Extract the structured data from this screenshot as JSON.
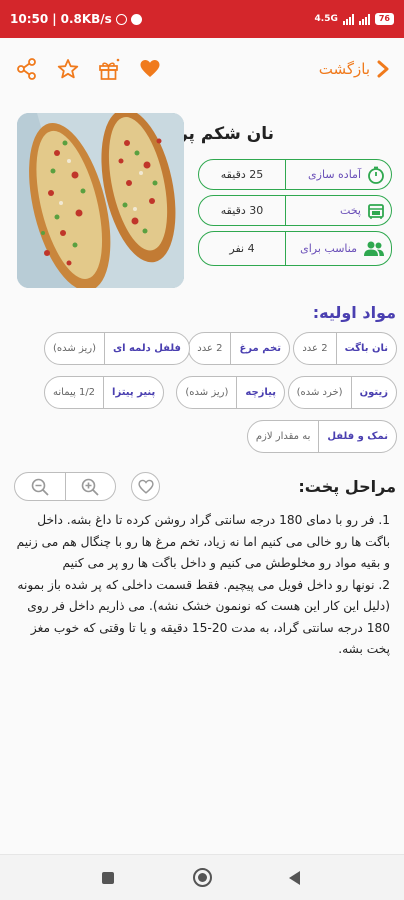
{
  "status": {
    "time": "10:50",
    "speed": "0.8KB/s",
    "network": "4.5G",
    "battery": "76"
  },
  "colors": {
    "status_red": "#d4262b",
    "accent_orange": "#f07a1c",
    "green": "#2fa84f",
    "purple": "#4a3fb0"
  },
  "toolbar": {
    "back_label": "بازگشت",
    "icons": [
      "share-icon",
      "star-icon",
      "gift-icon",
      "heart-icon"
    ]
  },
  "recipe": {
    "title": "نان شکم پر",
    "info": [
      {
        "icon": "clock-icon",
        "label": "آماده سازی",
        "value": "25 دقیقه"
      },
      {
        "icon": "oven-icon",
        "label": "پخت",
        "value": "30 دقیقه"
      },
      {
        "icon": "people-icon",
        "label": "مناسب برای",
        "value": "4 نفر"
      }
    ]
  },
  "ingredients": {
    "title": "مواد اولیه:",
    "items": [
      {
        "name": "نان باگت",
        "amount": "2 عدد"
      },
      {
        "name": "تخم مرغ",
        "amount": "2 عدد"
      },
      {
        "name": "فلفل دلمه ای",
        "amount": "(ریز شده)"
      },
      {
        "name": "زیتون",
        "amount": "(خرد شده)"
      },
      {
        "name": "پیازچه",
        "amount": "(ریز شده)"
      },
      {
        "name": "پنیر پیتزا",
        "amount": "1/2 پیمانه"
      },
      {
        "name": "نمک و فلفل",
        "amount": "به مقدار لازم"
      }
    ]
  },
  "steps": {
    "title": "مراحل پخت:",
    "paragraphs": [
      "1. فر رو با دمای 180 درجه سانتی گراد روشن کرده تا داغ بشه. داخل باگت ها رو خالی می کنیم اما نه زیاد، تخم مرغ ها رو با چنگال هم می زنیم و بقیه مواد رو مخلوطش می کنیم و داخل باگت ها رو پر می کنیم",
      "2. نونها رو داخل فویل می پیچیم. فقط قسمت داخلی که پر شده باز بمونه (دلیل این کار این هست که نونمون خشک نشه). می ذاریم داخل فر روی 180 درجه سانتی گراد، به مدت 20-15 دقیقه و یا تا وقتی که خوب مغز پخت بشه."
    ]
  }
}
